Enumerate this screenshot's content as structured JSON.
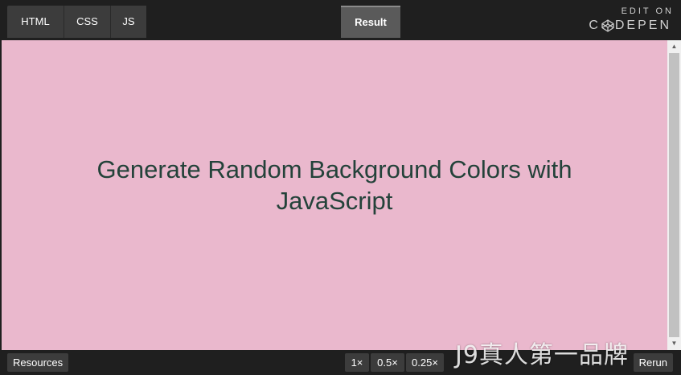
{
  "editor_tabs": [
    {
      "label": "HTML"
    },
    {
      "label": "CSS"
    },
    {
      "label": "JS"
    }
  ],
  "result_tab": {
    "label": "Result"
  },
  "codepen_link": {
    "line1": "EDIT ON",
    "line2_a": "C",
    "line2_b": "DEPEN"
  },
  "result_pane": {
    "background_color": "#eab8cd",
    "headline": "Generate Random Background Colors with JavaScript",
    "text_color": "#24423a"
  },
  "bottom_bar": {
    "resources_label": "Resources",
    "zoom_options": [
      "1×",
      "0.5×",
      "0.25×"
    ],
    "rerun_label": "Rerun"
  },
  "watermark": "J9真人第一品牌",
  "icons": {
    "scroll_up": "triangle-up",
    "scroll_down": "triangle-down",
    "logo": "codepen-cube"
  }
}
